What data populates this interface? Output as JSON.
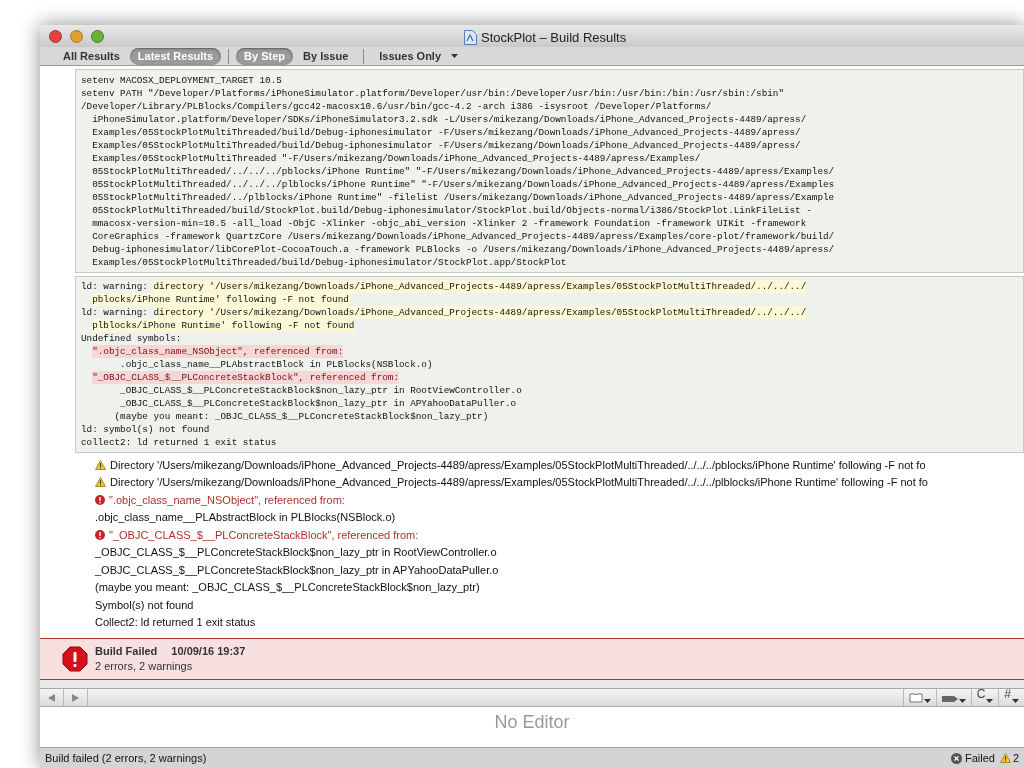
{
  "window": {
    "title": "StockPlot – Build Results"
  },
  "toolbar": {
    "scope_filters": [
      {
        "label": "All Results",
        "selected": false
      },
      {
        "label": "Latest Results",
        "selected": true
      }
    ],
    "view_filters": [
      {
        "label": "By Step",
        "selected": true
      },
      {
        "label": "By Issue",
        "selected": false
      }
    ],
    "issues_menu": {
      "label": "Issues Only"
    }
  },
  "log_blocks": [
    {
      "lines": [
        {
          "kind": "command",
          "segments": [
            {
              "kind": "plain",
              "text": "setenv MACOSX_DEPLOYMENT_TARGET 10.5"
            }
          ]
        },
        {
          "kind": "command",
          "segments": [
            {
              "kind": "plain",
              "text": "setenv PATH \"/Developer/Platforms/iPhoneSimulator.platform/Developer/usr/bin:/Developer/usr/bin:/usr/bin:/bin:/usr/sbin:/sbin\""
            }
          ]
        },
        {
          "kind": "command",
          "segments": [
            {
              "kind": "plain",
              "text": "/Developer/Library/PLBlocks/Compilers/gcc42-macosx10.6/usr/bin/gcc-4.2 -arch i386 -isysroot /Developer/Platforms/"
            }
          ]
        },
        {
          "kind": "continuation",
          "segments": [
            {
              "kind": "plain",
              "text": "iPhoneSimulator.platform/Developer/SDKs/iPhoneSimulator3.2.sdk -L/Users/mikezang/Downloads/iPhone_Advanced_Projects-4489/apress/"
            }
          ]
        },
        {
          "kind": "continuation",
          "segments": [
            {
              "kind": "plain",
              "text": "Examples/05StockPlotMultiThreaded/build/Debug-iphonesimulator -F/Users/mikezang/Downloads/iPhone_Advanced_Projects-4489/apress/"
            }
          ]
        },
        {
          "kind": "continuation",
          "segments": [
            {
              "kind": "plain",
              "text": "Examples/05StockPlotMultiThreaded/build/Debug-iphonesimulator -F/Users/mikezang/Downloads/iPhone_Advanced_Projects-4489/apress/"
            }
          ]
        },
        {
          "kind": "continuation",
          "segments": [
            {
              "kind": "plain",
              "text": "Examples/05StockPlotMultiThreaded \"-F/Users/mikezang/Downloads/iPhone_Advanced_Projects-4489/apress/Examples/"
            }
          ]
        },
        {
          "kind": "continuation",
          "segments": [
            {
              "kind": "plain",
              "text": "05StockPlotMultiThreaded/../../../pblocks/iPhone Runtime\" \"-F/Users/mikezang/Downloads/iPhone_Advanced_Projects-4489/apress/Examples/"
            }
          ]
        },
        {
          "kind": "continuation",
          "segments": [
            {
              "kind": "plain",
              "text": "05StockPlotMultiThreaded/../../../plblocks/iPhone Runtime\" \"-F/Users/mikezang/Downloads/iPhone_Advanced_Projects-4489/apress/Examples"
            }
          ]
        },
        {
          "kind": "continuation",
          "segments": [
            {
              "kind": "plain",
              "text": "05StockPlotMultiThreaded/../plblocks/iPhone Runtime\" -filelist /Users/mikezang/Downloads/iPhone_Advanced_Projects-4489/apress/Example"
            }
          ]
        },
        {
          "kind": "continuation",
          "segments": [
            {
              "kind": "plain",
              "text": "05StockPlotMultiThreaded/build/StockPlot.build/Debug-iphonesimulator/StockPlot.build/Objects-normal/i386/StockPlot.LinkFileList -"
            }
          ]
        },
        {
          "kind": "continuation",
          "segments": [
            {
              "kind": "plain",
              "text": "mmacosx-version-min=10.5 -all_load -ObjC -Xlinker -objc_abi_version -Xlinker 2 -framework Foundation -framework UIKit -framework"
            }
          ]
        },
        {
          "kind": "continuation",
          "segments": [
            {
              "kind": "plain",
              "text": "CoreGraphics -framework QuartzCore /Users/mikezang/Downloads/iPhone_Advanced_Projects-4489/apress/Examples/core-plot/framework/build/"
            }
          ]
        },
        {
          "kind": "continuation",
          "segments": [
            {
              "kind": "plain",
              "text": "Debug-iphonesimulator/libCorePlot-CocoaTouch.a -framework PLBlocks -o /Users/mikezang/Downloads/iPhone_Advanced_Projects-4489/apress/"
            }
          ]
        },
        {
          "kind": "continuation",
          "segments": [
            {
              "kind": "plain",
              "text": "Examples/05StockPlotMultiThreaded/build/Debug-iphonesimulator/StockPlot.app/StockPlot"
            }
          ]
        }
      ]
    },
    {
      "lines": [
        {
          "kind": "command",
          "segments": [
            {
              "kind": "plain",
              "text": "ld: warning:"
            },
            {
              "kind": "warning",
              "text": "directory '/Users/mikezang/Downloads/iPhone_Advanced_Projects-4489/apress/Examples/05StockPlotMultiThreaded/../../../"
            }
          ]
        },
        {
          "kind": "continuation",
          "segments": [
            {
              "kind": "warning",
              "text": "pblocks/iPhone Runtime' following -F not found"
            }
          ]
        },
        {
          "kind": "command",
          "segments": [
            {
              "kind": "plain",
              "text": "ld: warning:"
            },
            {
              "kind": "warning",
              "text": "directory '/Users/mikezang/Downloads/iPhone_Advanced_Projects-4489/apress/Examples/05StockPlotMultiThreaded/../../../"
            }
          ]
        },
        {
          "kind": "continuation",
          "segments": [
            {
              "kind": "warning",
              "text": "plblocks/iPhone Runtime' following -F not found"
            }
          ]
        },
        {
          "kind": "command",
          "segments": [
            {
              "kind": "plain",
              "text": "Undefined symbols:"
            }
          ]
        },
        {
          "kind": "continuation",
          "segments": [
            {
              "kind": "error",
              "text": "\".objc_class_name_NSObject\", referenced from:"
            }
          ]
        },
        {
          "kind": "reference",
          "segments": [
            {
              "kind": "plain",
              "text": ".objc_class_name__PLAbstractBlock in PLBlocks(NSBlock.o)"
            }
          ]
        },
        {
          "kind": "continuation",
          "segments": [
            {
              "kind": "error",
              "text": "\"_OBJC_CLASS_$__PLConcreteStackBlock\", referenced from:"
            }
          ]
        },
        {
          "kind": "reference",
          "segments": [
            {
              "kind": "plain",
              "text": "_OBJC_CLASS_$__PLConcreteStackBlock$non_lazy_ptr in RootViewController.o"
            }
          ]
        },
        {
          "kind": "reference",
          "segments": [
            {
              "kind": "plain",
              "text": "_OBJC_CLASS_$__PLConcreteStackBlock$non_lazy_ptr in APYahooDataPuller.o"
            }
          ]
        },
        {
          "kind": "suggestion",
          "segments": [
            {
              "kind": "plain",
              "text": "(maybe you meant: _OBJC_CLASS_$__PLConcreteStackBlock$non_lazy_ptr)"
            }
          ]
        },
        {
          "kind": "command",
          "segments": [
            {
              "kind": "plain",
              "text": "ld: symbol(s) not found"
            }
          ]
        },
        {
          "kind": "command",
          "segments": [
            {
              "kind": "plain",
              "text": "collect2: ld returned 1 exit status"
            }
          ]
        }
      ]
    }
  ],
  "issues": [
    {
      "kind": "warning",
      "text": "Directory '/Users/mikezang/Downloads/iPhone_Advanced_Projects-4489/apress/Examples/05StockPlotMultiThreaded/../../../pblocks/iPhone Runtime' following -F not fo"
    },
    {
      "kind": "warning",
      "text": "Directory '/Users/mikezang/Downloads/iPhone_Advanced_Projects-4489/apress/Examples/05StockPlotMultiThreaded/../../../plblocks/iPhone Runtime' following -F not fo"
    },
    {
      "kind": "error",
      "text": "\".objc_class_name_NSObject\", referenced from:"
    },
    {
      "kind": "note",
      "text": ".objc_class_name__PLAbstractBlock in PLBlocks(NSBlock.o)"
    },
    {
      "kind": "error",
      "text": "\"_OBJC_CLASS_$__PLConcreteStackBlock\", referenced from:"
    },
    {
      "kind": "note",
      "text": "_OBJC_CLASS_$__PLConcreteStackBlock$non_lazy_ptr in RootViewController.o"
    },
    {
      "kind": "note",
      "text": "_OBJC_CLASS_$__PLConcreteStackBlock$non_lazy_ptr in APYahooDataPuller.o"
    },
    {
      "kind": "note",
      "text": "(maybe you meant: _OBJC_CLASS_$__PLConcreteStackBlock$non_lazy_ptr)"
    },
    {
      "kind": "note",
      "text": "Symbol(s) not found"
    },
    {
      "kind": "note",
      "text": "Collect2: ld returned 1 exit status"
    }
  ],
  "build_banner": {
    "title": "Build Failed",
    "timestamp": "10/09/16 19:37",
    "summary": "2 errors, 2 warnings"
  },
  "editor_bar": {
    "menus": [
      {
        "kind": "book"
      },
      {
        "kind": "pen"
      },
      {
        "kind": "text",
        "label": "C"
      },
      {
        "kind": "text",
        "label": "#"
      }
    ]
  },
  "editor": {
    "placeholder_text": "No Editor"
  },
  "status_bar": {
    "message": "Build failed (2 errors, 2 warnings)",
    "result": "Failed",
    "warning_count": "2"
  }
}
